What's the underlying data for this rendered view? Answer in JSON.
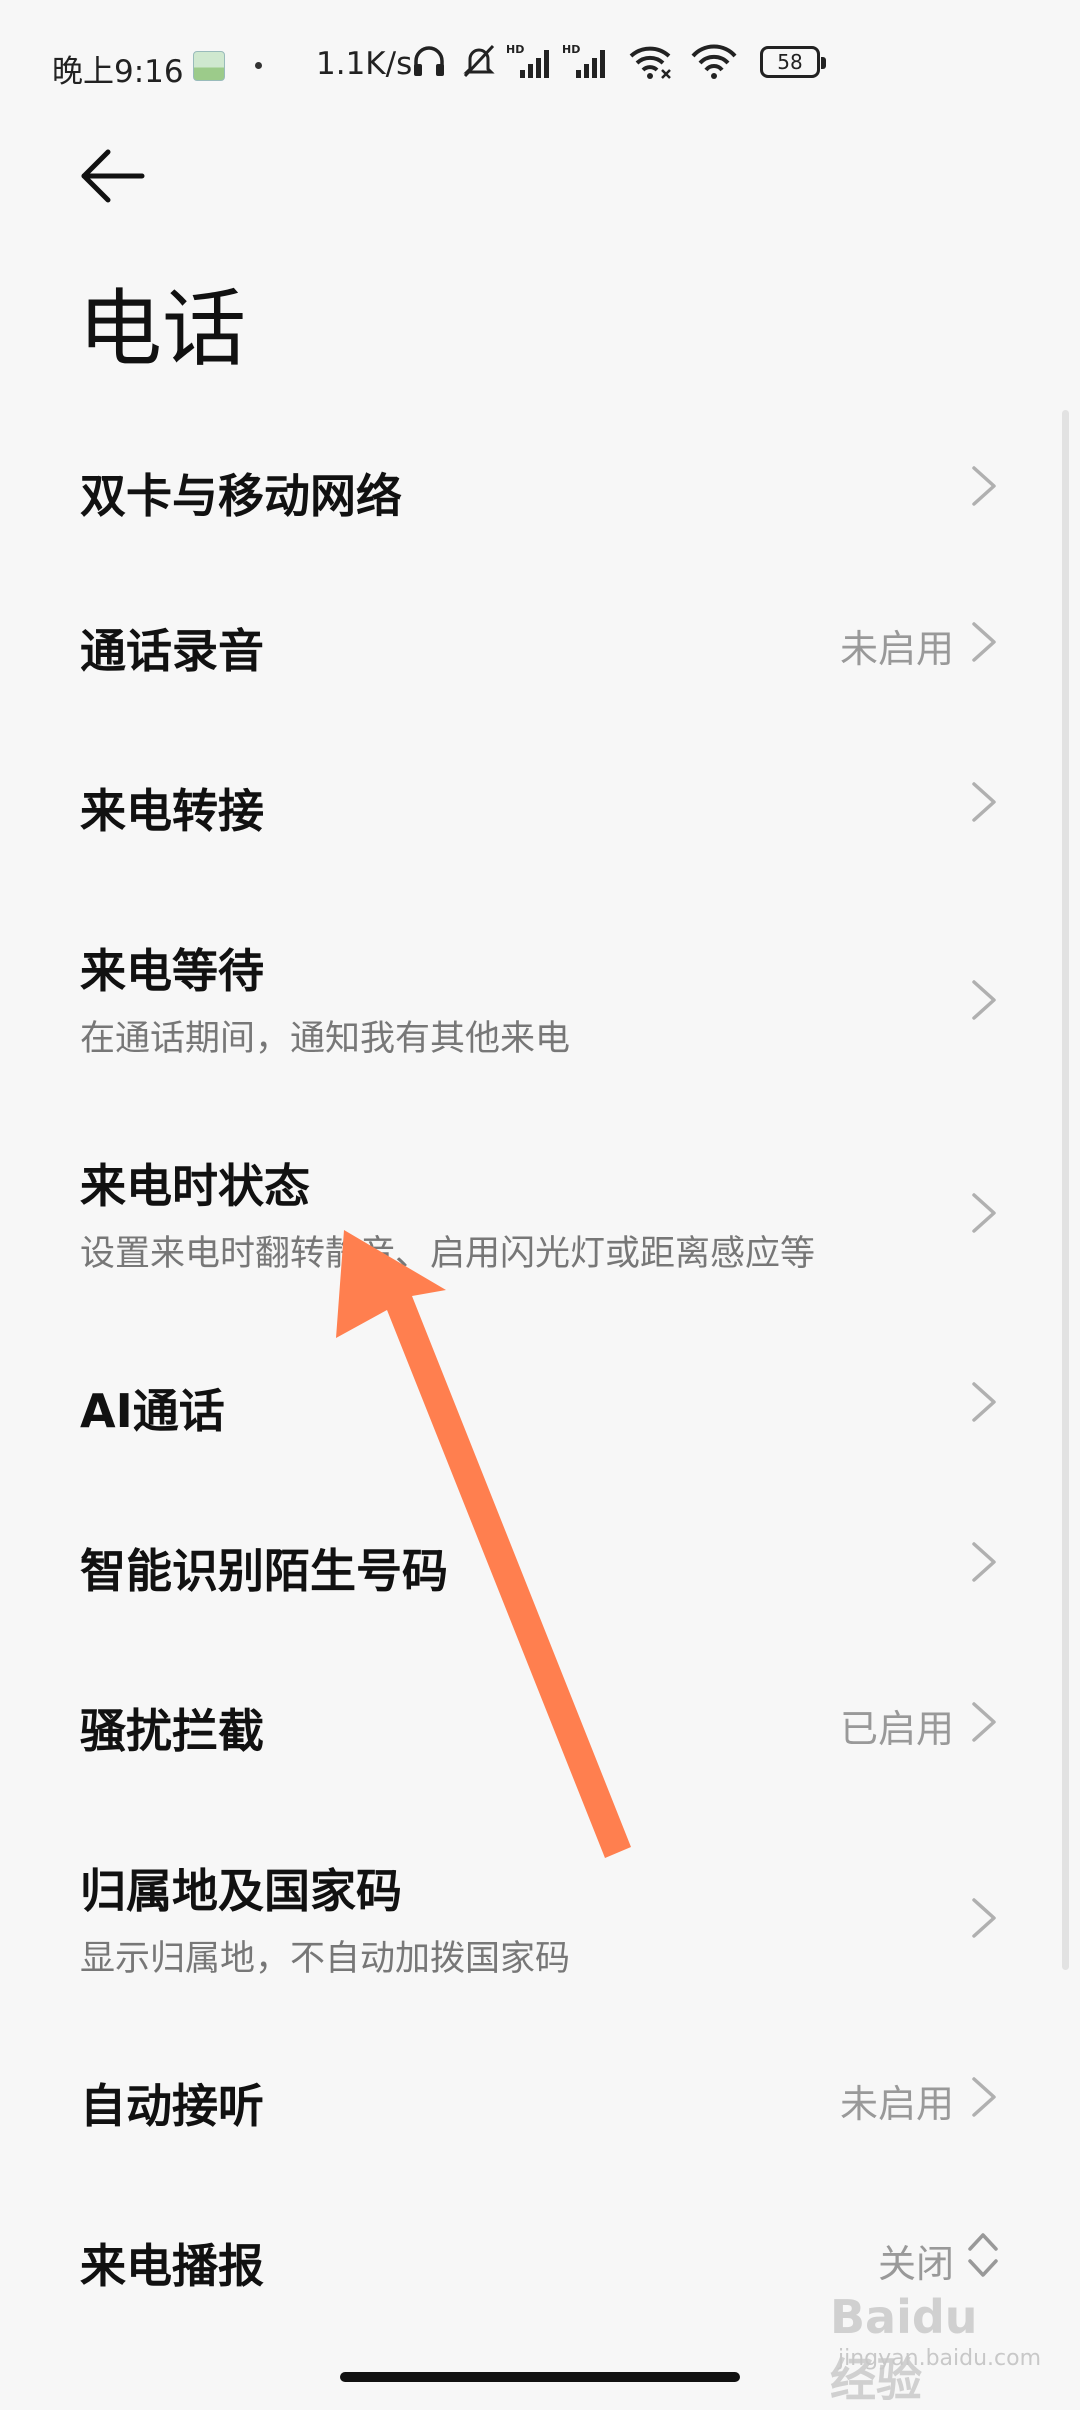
{
  "status_bar": {
    "time": "晚上9:16",
    "network_speed": "1.1K/s",
    "battery_level": "58",
    "icons": [
      "gallery-icon",
      "headphones-icon",
      "bell-off-icon",
      "hd-signal-icon",
      "hd-signal-icon",
      "wifi-calling-icon",
      "wifi-icon",
      "battery-icon"
    ]
  },
  "header": {
    "back_icon": "arrow-left-icon",
    "title": "电话"
  },
  "settings": {
    "items": [
      {
        "title": "双卡与移动网络",
        "subtitle": "",
        "value": "",
        "control": "chevron"
      },
      {
        "title": "通话录音",
        "subtitle": "",
        "value": "未启用",
        "control": "chevron"
      },
      {
        "title": "来电转接",
        "subtitle": "",
        "value": "",
        "control": "chevron"
      },
      {
        "title": "来电等待",
        "subtitle": "在通话期间，通知我有其他来电",
        "value": "",
        "control": "chevron"
      },
      {
        "title": "来电时状态",
        "subtitle": "设置来电时翻转静音、启用闪光灯或距离感应等",
        "value": "",
        "control": "chevron"
      },
      {
        "title": "AI通话",
        "subtitle": "",
        "value": "",
        "control": "chevron"
      },
      {
        "title": "智能识别陌生号码",
        "subtitle": "",
        "value": "",
        "control": "chevron"
      },
      {
        "title": "骚扰拦截",
        "subtitle": "",
        "value": "已启用",
        "control": "chevron"
      },
      {
        "title": "归属地及国家码",
        "subtitle": "显示归属地，不自动加拨国家码",
        "value": "",
        "control": "chevron"
      },
      {
        "title": "自动接听",
        "subtitle": "",
        "value": "未启用",
        "control": "chevron"
      },
      {
        "title": "来电播报",
        "subtitle": "",
        "value": "关闭",
        "control": "dropdown"
      }
    ]
  },
  "watermark": {
    "brand": "Baidu经验",
    "url": "jingyan.baidu.com"
  },
  "colors": {
    "background": "#f7f7f7",
    "title_text": "#111111",
    "secondary_text": "#777777",
    "value_text": "#999999",
    "annotation_arrow": "#ff7f4f"
  }
}
